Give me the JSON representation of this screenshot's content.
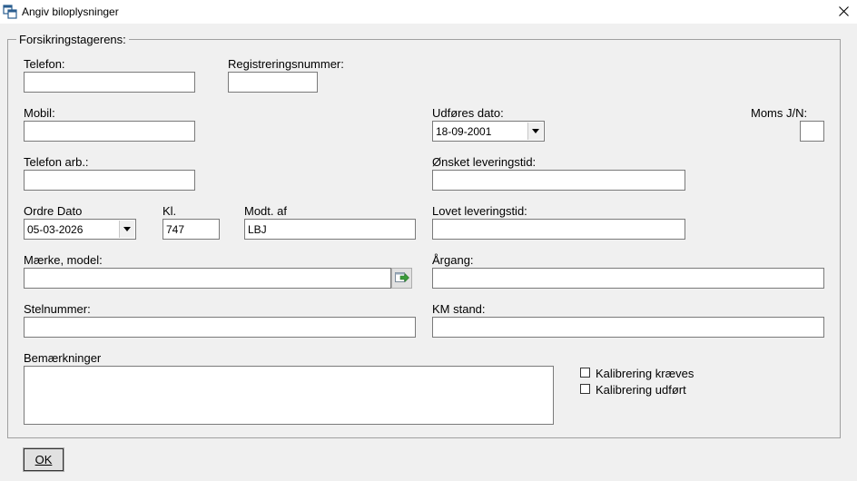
{
  "window": {
    "title": "Angiv biloplysninger",
    "icon": "window-restore-icon",
    "close_icon": "close-icon"
  },
  "group": {
    "legend": "Forsikringstagerens:"
  },
  "fields": {
    "telefon": {
      "label": "Telefon:",
      "value": ""
    },
    "registreringsnummer": {
      "label": "Registreringsnummer:",
      "value": ""
    },
    "mobil": {
      "label": "Mobil:",
      "value": ""
    },
    "udfores_dato": {
      "label": "Udføres dato:",
      "value": "18-09-2001"
    },
    "moms": {
      "label": "Moms J/N:",
      "value": ""
    },
    "telefon_arb": {
      "label": "Telefon arb.:",
      "value": ""
    },
    "onsket_leveringstid": {
      "label": "Ønsket leveringstid:",
      "value": ""
    },
    "ordre_dato": {
      "label": "Ordre Dato",
      "value": "05-03-2026"
    },
    "kl": {
      "label": "Kl.",
      "value": "747"
    },
    "modt_af": {
      "label": "Modt. af",
      "value": "LBJ"
    },
    "lovet_leveringstid": {
      "label": "Lovet leveringstid:",
      "value": ""
    },
    "maerke_model": {
      "label": "Mærke, model:",
      "value": "",
      "lookup_icon": "green-arrow-icon"
    },
    "argang": {
      "label": "Årgang:",
      "value": ""
    },
    "stelnummer": {
      "label": "Stelnummer:",
      "value": ""
    },
    "km_stand": {
      "label": "KM stand:",
      "value": ""
    },
    "bemaerkninger": {
      "label": "Bemærkninger",
      "value": ""
    }
  },
  "checkboxes": {
    "kalibrering_kraeves": {
      "label": "Kalibrering kræves",
      "checked": false
    },
    "kalibrering_udfort": {
      "label": "Kalibrering udført",
      "checked": false
    }
  },
  "buttons": {
    "ok": "OK"
  },
  "colors": {
    "background": "#f0f0f0",
    "border": "#7a7a7a",
    "accent_green": "#3a9a3a"
  }
}
